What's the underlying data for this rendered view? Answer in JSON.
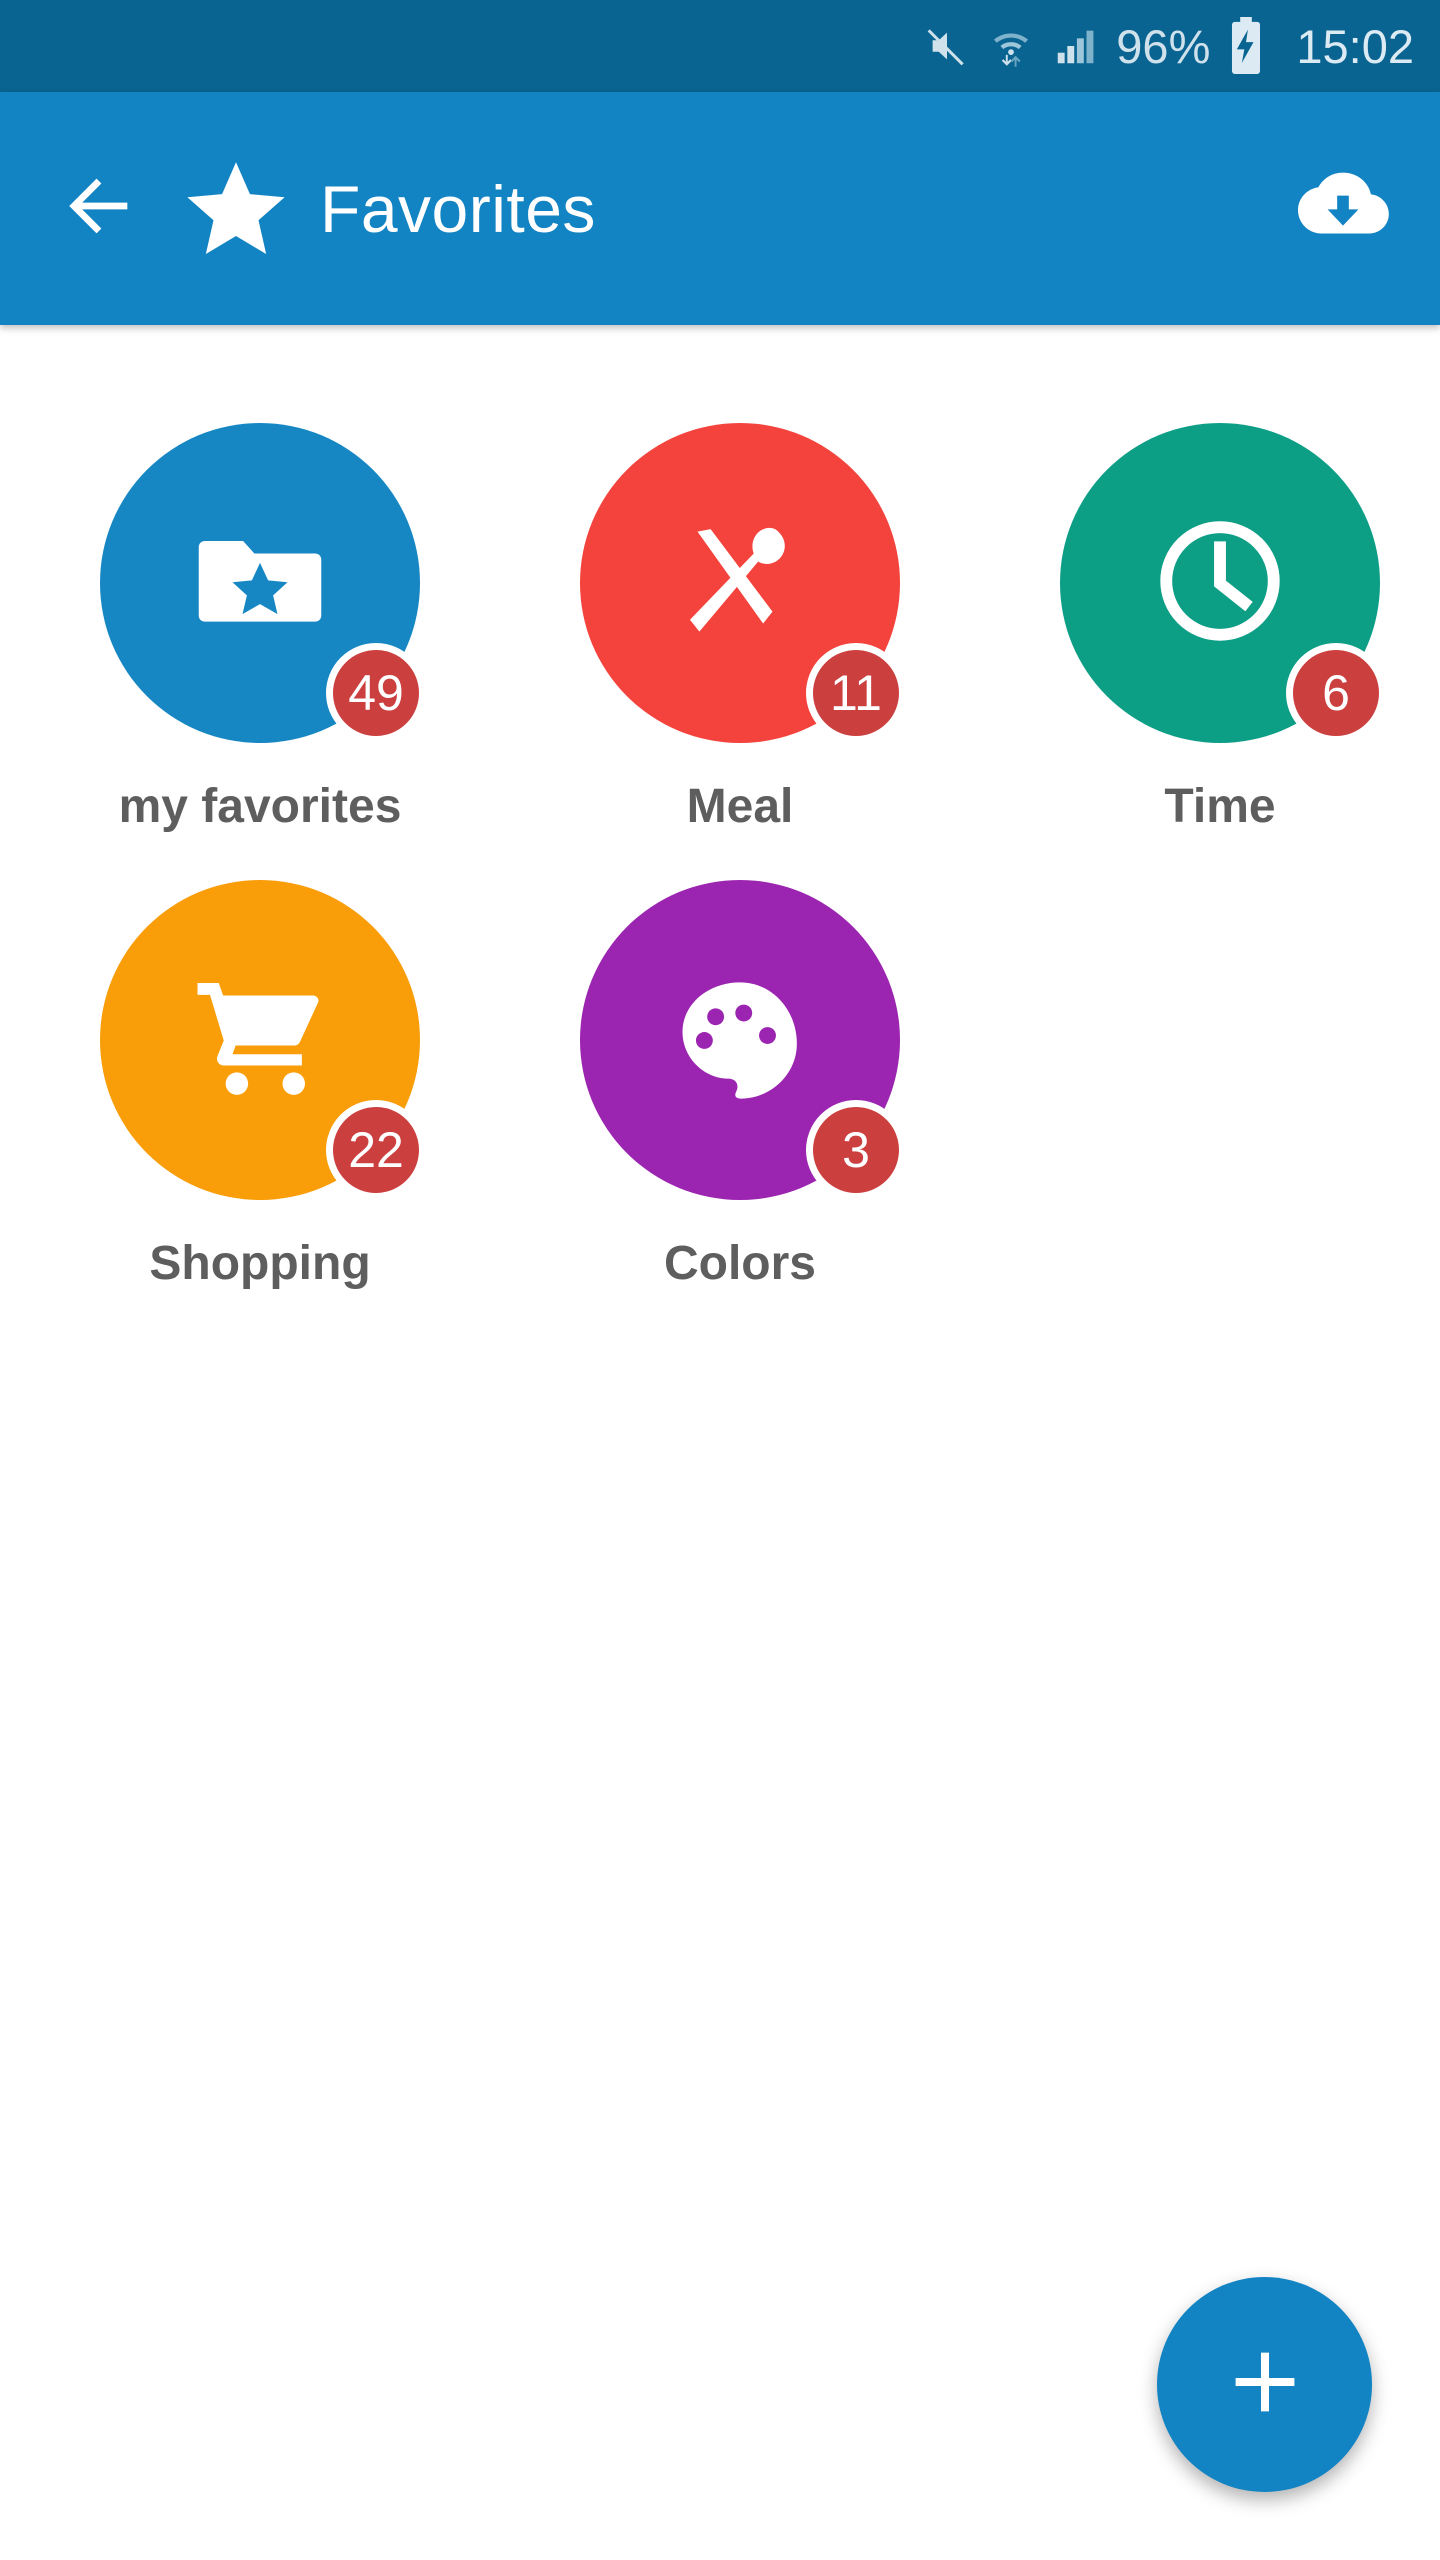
{
  "status_bar": {
    "background": "#0a6491",
    "mute_icon": "mute-icon",
    "wifi_icon": "wifi-icon",
    "signal_icon": "cellular-signal-icon",
    "battery_percent": "96%",
    "battery_icon": "battery-charging-icon",
    "clock": "15:02"
  },
  "app_bar": {
    "background": "#1283c3",
    "back_icon": "arrow-left-icon",
    "star_icon": "star-icon",
    "title": "Favorites",
    "download_icon": "cloud-download-icon"
  },
  "categories": [
    {
      "label": "my favorites",
      "count": "49",
      "color": "#1787c4",
      "icon": "folder-star-icon"
    },
    {
      "label": "Meal",
      "count": "11",
      "color": "#f4433c",
      "icon": "cutlery-icon"
    },
    {
      "label": "Time",
      "count": "6",
      "color": "#0d9e86",
      "icon": "clock-icon"
    },
    {
      "label": "Shopping",
      "count": "22",
      "color": "#f99d08",
      "icon": "shopping-cart-icon"
    },
    {
      "label": "Colors",
      "count": "3",
      "color": "#9b24b0",
      "icon": "palette-icon"
    }
  ],
  "fab": {
    "label": "+",
    "icon": "plus-icon",
    "color": "#1283c3"
  },
  "badge_color": "#cc3f3f",
  "label_color": "#5e5e5e"
}
